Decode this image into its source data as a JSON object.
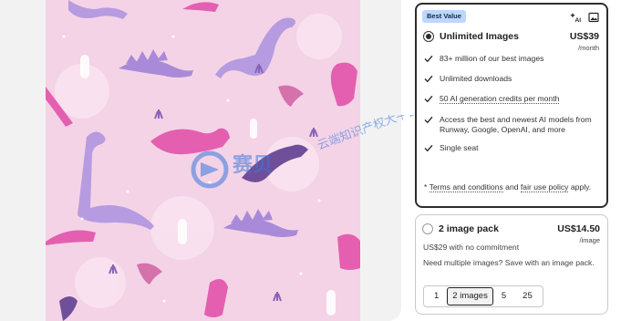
{
  "preview": {
    "background_color": "#f4d3e6",
    "dino_colors": [
      "#b69be0",
      "#e45fb0",
      "#8a63b8",
      "#cf5fa0",
      "#a98ad9"
    ]
  },
  "watermark": {
    "brand_text": "赛贝",
    "secondary_text": "云端知识产权大平台",
    "color": "#3a78e0"
  },
  "plans": [
    {
      "badge": "Best Value",
      "name": "Unlimited Images",
      "price": "US$39",
      "period": "/month",
      "selected": true,
      "features": [
        "83+ million of our best images",
        "Unlimited downloads",
        "50 AI generation credits per month",
        "Access the best and newest AI models from Runway, Google, OpenAI, and more",
        "Single seat"
      ],
      "terms_prefix": "* ",
      "terms_link": "Terms and conditions",
      "terms_mid": " and ",
      "fair_use_link": "fair use policy",
      "terms_suffix": " apply."
    },
    {
      "name": "2 image pack",
      "price": "US$14.50",
      "period": "/image",
      "selected": false,
      "subtitle": "US$29 with no commitment",
      "description": "Need multiple images? Save with an image pack.",
      "options": [
        "1",
        "2 images",
        "5",
        "25"
      ],
      "active_option": "2 images"
    }
  ],
  "icons": {
    "ai": "ai-sparkle-icon",
    "image": "image-icon",
    "check": "check-icon"
  }
}
